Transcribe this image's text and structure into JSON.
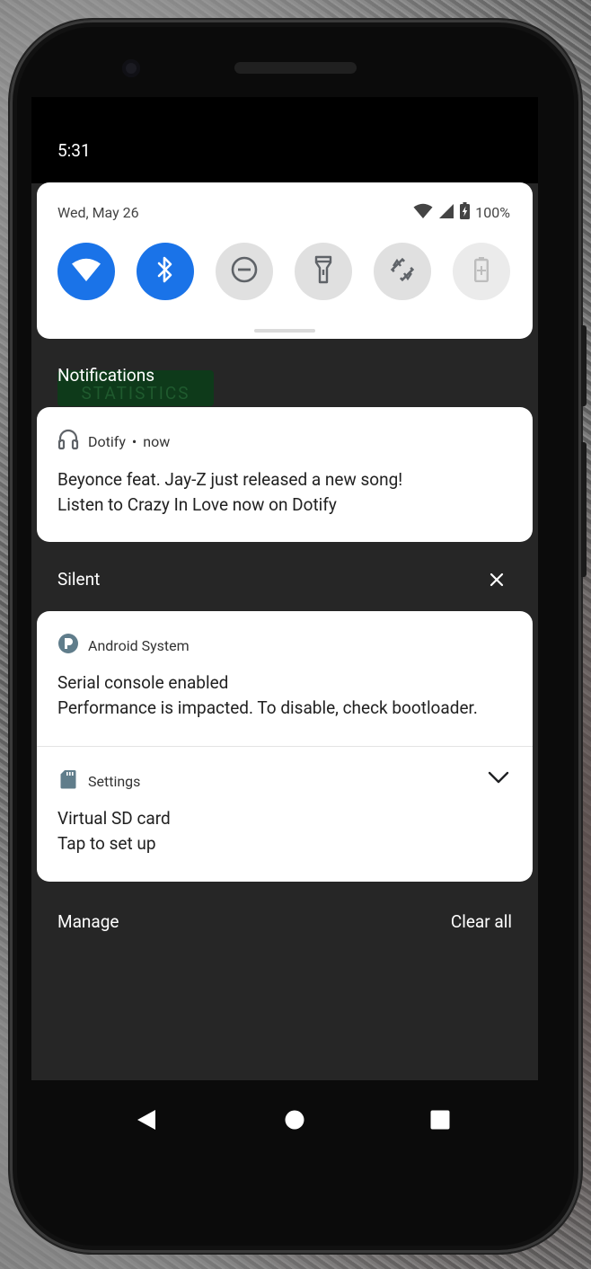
{
  "status": {
    "time": "5:31"
  },
  "quick_settings": {
    "date": "Wed, May 26",
    "battery": "100%",
    "tiles": [
      {
        "name": "wifi",
        "state": "on"
      },
      {
        "name": "bluetooth",
        "state": "on"
      },
      {
        "name": "do-not-disturb",
        "state": "off"
      },
      {
        "name": "flashlight",
        "state": "off"
      },
      {
        "name": "auto-rotate",
        "state": "off"
      },
      {
        "name": "battery-saver",
        "state": "disabled"
      }
    ]
  },
  "notifications": {
    "section_title": "Notifications",
    "background_ghost_text": "STATISTICS",
    "dotify": {
      "app": "Dotify",
      "dot": "•",
      "time": "now",
      "title": "Beyonce feat. Jay-Z just released a new song!",
      "text": "Listen to Crazy In Love now on Dotify"
    }
  },
  "silent": {
    "section_title": "Silent",
    "android_system": {
      "app": "Android System",
      "title": "Serial console enabled",
      "text": "Performance is impacted. To disable, check bootloader."
    },
    "settings": {
      "app": "Settings",
      "title": "Virtual SD card",
      "text": "Tap to set up"
    }
  },
  "footer": {
    "manage": "Manage",
    "clear_all": "Clear all"
  }
}
